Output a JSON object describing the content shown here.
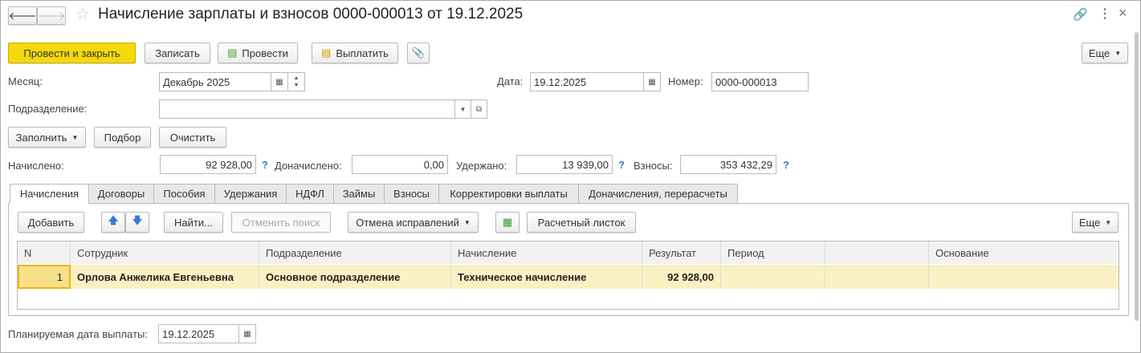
{
  "title": "Начисление зарплаты и взносов 0000-000013 от 19.12.2025",
  "toolbar": {
    "post_close": "Провести и закрыть",
    "save": "Записать",
    "post": "Провести",
    "pay": "Выплатить",
    "more": "Еще"
  },
  "form": {
    "month_label": "Месяц:",
    "month_value": "Декабрь 2025",
    "date_label": "Дата:",
    "date_value": "19.12.2025",
    "number_label": "Номер:",
    "number_value": "0000-000013",
    "dept_label": "Подразделение:",
    "dept_value": "",
    "fill": "Заполнить",
    "pick": "Подбор",
    "clear": "Очистить",
    "accrued_label": "Начислено:",
    "accrued_value": "92 928,00",
    "extra_label": "Доначислено:",
    "extra_value": "0,00",
    "withheld_label": "Удержано:",
    "withheld_value": "13 939,00",
    "contrib_label": "Взносы:",
    "contrib_value": "353 432,29",
    "help": "?",
    "pay_date_label": "Планируемая дата выплаты:",
    "pay_date_value": "19.12.2025"
  },
  "tabs": [
    "Начисления",
    "Договоры",
    "Пособия",
    "Удержания",
    "НДФЛ",
    "Займы",
    "Взносы",
    "Корректировки выплаты",
    "Доначисления, перерасчеты"
  ],
  "table_toolbar": {
    "add": "Добавить",
    "find": "Найти...",
    "cancel_search": "Отменить поиск",
    "undo_corrections": "Отмена исправлений",
    "payslip": "Расчетный листок",
    "more": "Еще"
  },
  "table": {
    "columns": [
      "N",
      "Сотрудник",
      "Подразделение",
      "Начисление",
      "Результат",
      "Период",
      "",
      "Основание"
    ],
    "rows": [
      [
        "1",
        "Орлова Анжелика Евгеньевна",
        "Основное подразделение",
        "Техническое начисление",
        "92 928,00",
        "",
        "",
        ""
      ]
    ]
  }
}
